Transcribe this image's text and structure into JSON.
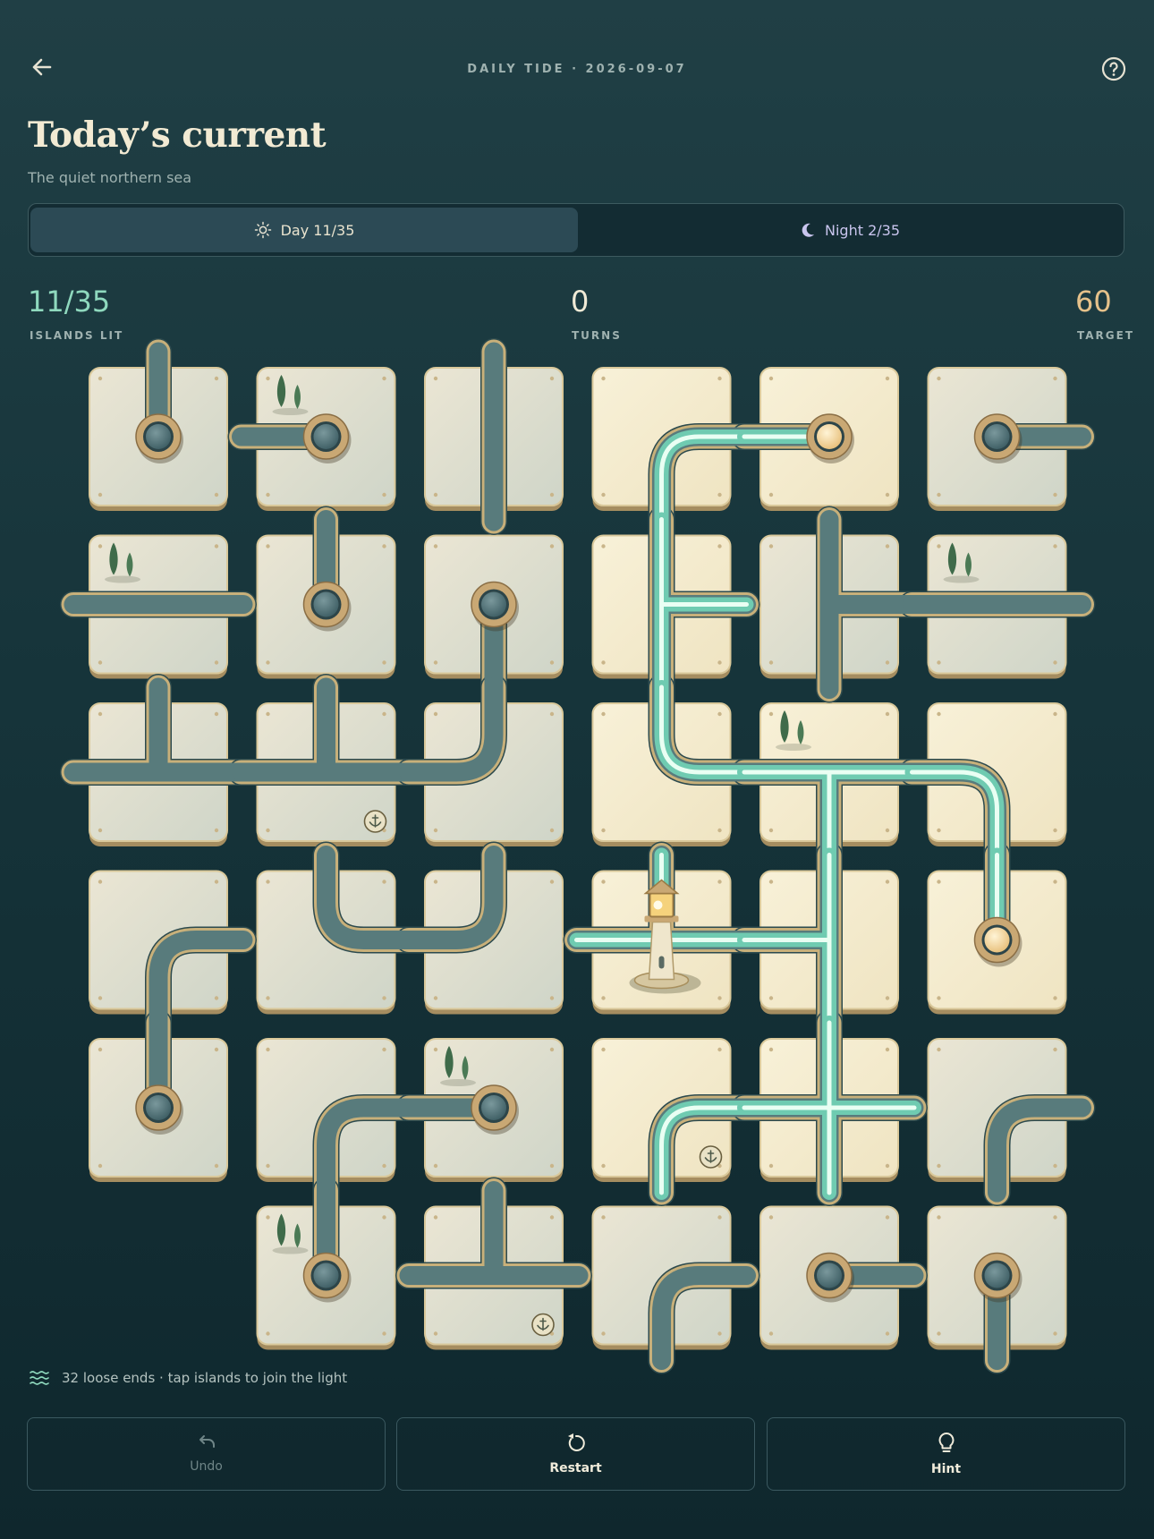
{
  "header": {
    "back_icon": "arrow-left-icon",
    "daily_label": "DAILY TIDE · 2026-09-07",
    "help_icon": "question-circle-icon"
  },
  "title": "Today’s current",
  "subtitle": "The quiet northern sea",
  "mode_toggle": {
    "day_label": "Day 11/35",
    "day_icon": "sun-icon",
    "night_label": "Night 2/35",
    "night_icon": "moon-icon",
    "selected": "day"
  },
  "stats": {
    "islands_lit_value": "11/35",
    "islands_lit_label": "ISLANDS LIT",
    "turns_value": "0",
    "turns_label": "TURNS",
    "target_value": "60",
    "target_label": "TARGET"
  },
  "board": {
    "rows": 6,
    "cols": 6,
    "missing_tiles": [
      [
        5,
        0
      ]
    ],
    "lighthouse": {
      "row": 3,
      "col": 3
    },
    "colors": {
      "pipe": "#587b7c",
      "pipe_outline": "#c8b07a",
      "lit_pipe": "#8fe0c8",
      "tile_dark": "#d8dccd",
      "tile_lit": "#f7efd4",
      "node_ring": "#c9a874",
      "node_dark": "#3d5d63",
      "node_lit": "#f0d59a"
    },
    "tiles": [
      {
        "r": 0,
        "c": 0,
        "lit": false,
        "ends": [
          "N"
        ],
        "node": true
      },
      {
        "r": 0,
        "c": 1,
        "lit": false,
        "ends": [
          "W"
        ],
        "node": true,
        "trees": true
      },
      {
        "r": 0,
        "c": 2,
        "lit": false,
        "ends": [
          "N",
          "S"
        ]
      },
      {
        "r": 0,
        "c": 3,
        "lit": true,
        "ends": [
          "E",
          "S"
        ]
      },
      {
        "r": 0,
        "c": 4,
        "lit": true,
        "ends": [
          "W"
        ],
        "node": true
      },
      {
        "r": 0,
        "c": 5,
        "lit": false,
        "ends": [
          "E"
        ],
        "node": true
      },
      {
        "r": 1,
        "c": 0,
        "lit": false,
        "ends": [
          "W",
          "E"
        ],
        "trees": true
      },
      {
        "r": 1,
        "c": 1,
        "lit": false,
        "ends": [
          "N"
        ],
        "node": true
      },
      {
        "r": 1,
        "c": 2,
        "lit": false,
        "ends": [
          "S"
        ],
        "node": true
      },
      {
        "r": 1,
        "c": 3,
        "lit": true,
        "ends": [
          "N",
          "S",
          "E"
        ]
      },
      {
        "r": 1,
        "c": 4,
        "lit": false,
        "ends": [
          "N",
          "S",
          "E"
        ]
      },
      {
        "r": 1,
        "c": 5,
        "lit": false,
        "ends": [
          "W",
          "E"
        ],
        "trees": true
      },
      {
        "r": 2,
        "c": 0,
        "lit": false,
        "ends": [
          "N",
          "W",
          "E"
        ]
      },
      {
        "r": 2,
        "c": 1,
        "lit": false,
        "ends": [
          "N",
          "W",
          "E"
        ],
        "anchor": true
      },
      {
        "r": 2,
        "c": 2,
        "lit": false,
        "ends": [
          "N",
          "W"
        ]
      },
      {
        "r": 2,
        "c": 3,
        "lit": true,
        "ends": [
          "N",
          "E"
        ]
      },
      {
        "r": 2,
        "c": 4,
        "lit": true,
        "ends": [
          "W",
          "E",
          "S"
        ],
        "trees": true
      },
      {
        "r": 2,
        "c": 5,
        "lit": true,
        "ends": [
          "W",
          "S"
        ]
      },
      {
        "r": 3,
        "c": 0,
        "lit": false,
        "ends": [
          "E",
          "S"
        ]
      },
      {
        "r": 3,
        "c": 1,
        "lit": false,
        "ends": [
          "N",
          "E"
        ]
      },
      {
        "r": 3,
        "c": 2,
        "lit": false,
        "ends": [
          "N",
          "W"
        ]
      },
      {
        "r": 3,
        "c": 3,
        "lit": true,
        "ends": [
          "N",
          "W",
          "E"
        ],
        "lighthouse": true
      },
      {
        "r": 3,
        "c": 4,
        "lit": true,
        "ends": [
          "N",
          "S",
          "W"
        ]
      },
      {
        "r": 3,
        "c": 5,
        "lit": true,
        "ends": [
          "N"
        ],
        "node": true
      },
      {
        "r": 4,
        "c": 0,
        "lit": false,
        "ends": [
          "N"
        ],
        "node": true
      },
      {
        "r": 4,
        "c": 1,
        "lit": false,
        "ends": [
          "E",
          "S"
        ]
      },
      {
        "r": 4,
        "c": 2,
        "lit": false,
        "ends": [
          "W"
        ],
        "node": true,
        "trees": true
      },
      {
        "r": 4,
        "c": 3,
        "lit": true,
        "ends": [
          "E",
          "S"
        ],
        "anchor": true
      },
      {
        "r": 4,
        "c": 4,
        "lit": true,
        "ends": [
          "N",
          "S",
          "W",
          "E"
        ]
      },
      {
        "r": 4,
        "c": 5,
        "lit": false,
        "ends": [
          "E",
          "S"
        ]
      },
      {
        "r": 5,
        "c": 1,
        "lit": false,
        "ends": [
          "N"
        ],
        "node": true,
        "trees": true
      },
      {
        "r": 5,
        "c": 2,
        "lit": false,
        "ends": [
          "N",
          "W",
          "E"
        ],
        "anchor": true
      },
      {
        "r": 5,
        "c": 3,
        "lit": false,
        "ends": [
          "E",
          "S"
        ]
      },
      {
        "r": 5,
        "c": 4,
        "lit": false,
        "ends": [
          "E"
        ],
        "node": true
      },
      {
        "r": 5,
        "c": 5,
        "lit": false,
        "ends": [
          "S"
        ],
        "node": true
      }
    ]
  },
  "status": {
    "icon": "waves-icon",
    "text": "32 loose ends · tap islands to join the light"
  },
  "actions": {
    "undo_label": "Undo",
    "undo_icon": "undo-icon",
    "restart_label": "Restart",
    "restart_icon": "restart-icon",
    "hint_label": "Hint",
    "hint_icon": "lightbulb-icon"
  }
}
